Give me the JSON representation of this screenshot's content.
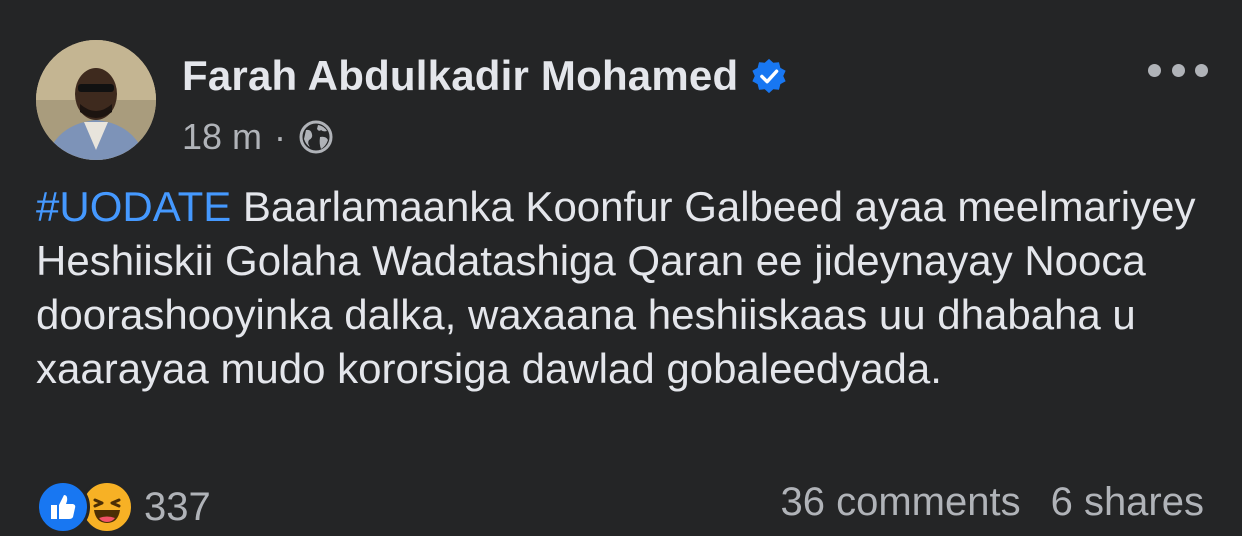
{
  "post": {
    "author": "Farah Abdulkadir Mohamed",
    "time": "18 m",
    "separator": "·",
    "hashtag": "#UODATE",
    "text": " Baarlamaanka Koonfur Galbeed ayaa meelmariyey Heshiiskii Golaha Wadatashiga Qaran ee jideynayay Nooca doorashooyinka dalka, waxaana heshiiskaas uu dhabaha u xaarayaa mudo kororsiga dawlad gobaleedyada.",
    "reaction_count": "337",
    "comments": "36 comments",
    "shares": "6 shares"
  },
  "icons": {
    "verified": "verified-badge-icon",
    "privacy": "globe-icon",
    "menu": "more-options-icon",
    "reactions": [
      "like-icon",
      "haha-icon"
    ]
  },
  "colors": {
    "background": "#242526",
    "text": "#e4e6eb",
    "secondary": "#b0b3b8",
    "hashtag": "#4599ff",
    "verified": "#1877f2"
  }
}
